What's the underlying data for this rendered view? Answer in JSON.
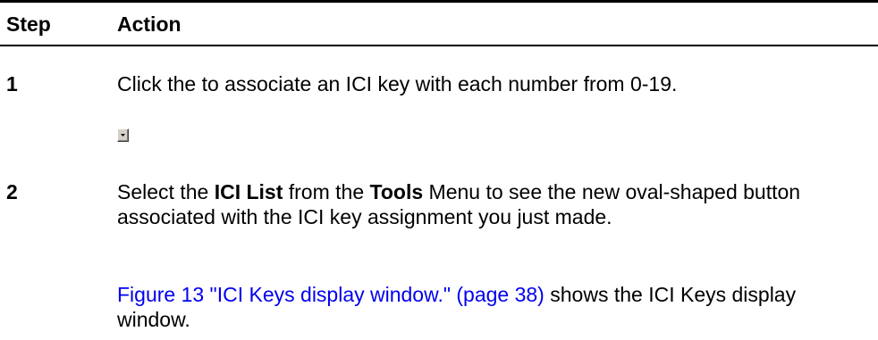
{
  "table": {
    "headers": {
      "step": "Step",
      "action": "Action"
    },
    "steps": [
      {
        "number": "1",
        "text": "Click the to associate an ICI key with each number from 0-19.",
        "icon": "dropdown-arrow-icon"
      },
      {
        "number": "2",
        "text_parts": {
          "p1": "Select the ",
          "b1": "ICI List",
          "p2": " from the ",
          "b2": "Tools",
          "p3": " Menu to see the new oval-shaped button associated with the ICI key assignment you just made."
        },
        "note": {
          "link": "Figure 13 \"ICI Keys display window.\" (page 38)",
          "rest": " shows the ICI Keys display window."
        }
      }
    ]
  },
  "colors": {
    "link": "#0000ee",
    "rule": "#000000"
  }
}
